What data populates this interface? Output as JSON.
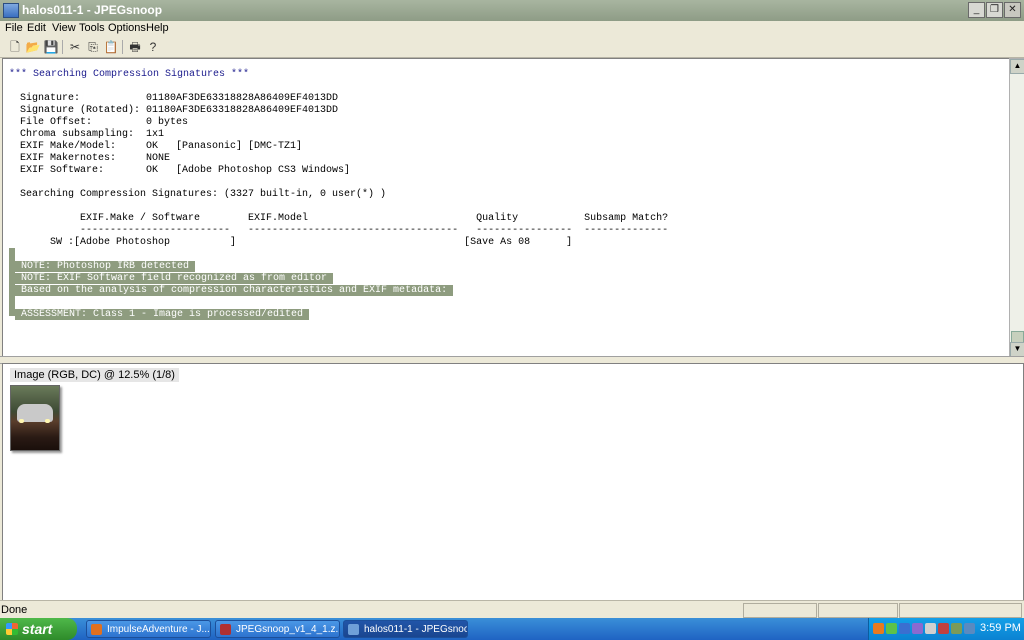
{
  "window": {
    "title": "halos011-1 - JPEGsnoop"
  },
  "menu": [
    "File",
    "Edit",
    "View",
    "Tools",
    "Options",
    "Help"
  ],
  "toolbar_icons": [
    "new-icon",
    "open-icon",
    "save-icon",
    "cut-icon",
    "copy-icon",
    "paste-icon",
    "print-icon",
    "help-icon"
  ],
  "report": {
    "heading": "*** Searching Compression Signatures ***",
    "lines": [
      "Signature:           01180AF3DE63318828A86409EF4013DD",
      "Signature (Rotated): 01180AF3DE63318828A86409EF4013DD",
      "File Offset:         0 bytes",
      "Chroma subsampling:  1x1",
      "EXIF Make/Model:     OK   [Panasonic] [DMC-TZ1]",
      "EXIF Makernotes:     NONE",
      "EXIF Software:       OK   [Adobe Photoshop CS3 Windows]"
    ],
    "searching": "Searching Compression Signatures: (3327 built-in, 0 user(*) )",
    "table_header": "        EXIF.Make / Software        EXIF.Model                            Quality           Subsamp Match?",
    "table_rule": "        -------------------------   -----------------------------------   ----------------  --------------",
    "table_row": "   SW :[Adobe Photoshop          ]                                      [Save As 08      ]",
    "notes": [
      "NOTE: Photoshop IRB detected",
      "NOTE: EXIF Software field recognized as from editor",
      "Based on the analysis of compression characteristics and EXIF metadata:"
    ],
    "assessment": "ASSESSMENT: Class 1 - Image is processed/edited"
  },
  "image_pane": {
    "label": "Image (RGB, DC) @ 12.5% (1/8)"
  },
  "statusbar": {
    "text": "Done"
  },
  "taskbar": {
    "start": "start",
    "tasks": [
      {
        "label": "ImpulseAdventure - J...",
        "icon_color": "#e07020",
        "active": false
      },
      {
        "label": "JPEGsnoop_v1_4_1.z...",
        "icon_color": "#b03030",
        "active": false
      },
      {
        "label": "halos011-1 - JPEGsnoop",
        "icon_color": "#6fa0d8",
        "active": true
      }
    ],
    "clock": "3:59 PM"
  }
}
